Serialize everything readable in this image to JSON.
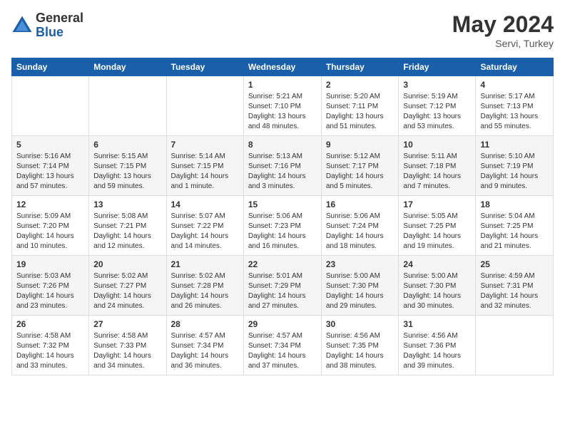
{
  "header": {
    "logo_general": "General",
    "logo_blue": "Blue",
    "month_year": "May 2024",
    "location": "Servi, Turkey"
  },
  "weekdays": [
    "Sunday",
    "Monday",
    "Tuesday",
    "Wednesday",
    "Thursday",
    "Friday",
    "Saturday"
  ],
  "weeks": [
    [
      {
        "day": "",
        "info": ""
      },
      {
        "day": "",
        "info": ""
      },
      {
        "day": "",
        "info": ""
      },
      {
        "day": "1",
        "info": "Sunrise: 5:21 AM\nSunset: 7:10 PM\nDaylight: 13 hours\nand 48 minutes."
      },
      {
        "day": "2",
        "info": "Sunrise: 5:20 AM\nSunset: 7:11 PM\nDaylight: 13 hours\nand 51 minutes."
      },
      {
        "day": "3",
        "info": "Sunrise: 5:19 AM\nSunset: 7:12 PM\nDaylight: 13 hours\nand 53 minutes."
      },
      {
        "day": "4",
        "info": "Sunrise: 5:17 AM\nSunset: 7:13 PM\nDaylight: 13 hours\nand 55 minutes."
      }
    ],
    [
      {
        "day": "5",
        "info": "Sunrise: 5:16 AM\nSunset: 7:14 PM\nDaylight: 13 hours\nand 57 minutes."
      },
      {
        "day": "6",
        "info": "Sunrise: 5:15 AM\nSunset: 7:15 PM\nDaylight: 13 hours\nand 59 minutes."
      },
      {
        "day": "7",
        "info": "Sunrise: 5:14 AM\nSunset: 7:15 PM\nDaylight: 14 hours\nand 1 minute."
      },
      {
        "day": "8",
        "info": "Sunrise: 5:13 AM\nSunset: 7:16 PM\nDaylight: 14 hours\nand 3 minutes."
      },
      {
        "day": "9",
        "info": "Sunrise: 5:12 AM\nSunset: 7:17 PM\nDaylight: 14 hours\nand 5 minutes."
      },
      {
        "day": "10",
        "info": "Sunrise: 5:11 AM\nSunset: 7:18 PM\nDaylight: 14 hours\nand 7 minutes."
      },
      {
        "day": "11",
        "info": "Sunrise: 5:10 AM\nSunset: 7:19 PM\nDaylight: 14 hours\nand 9 minutes."
      }
    ],
    [
      {
        "day": "12",
        "info": "Sunrise: 5:09 AM\nSunset: 7:20 PM\nDaylight: 14 hours\nand 10 minutes."
      },
      {
        "day": "13",
        "info": "Sunrise: 5:08 AM\nSunset: 7:21 PM\nDaylight: 14 hours\nand 12 minutes."
      },
      {
        "day": "14",
        "info": "Sunrise: 5:07 AM\nSunset: 7:22 PM\nDaylight: 14 hours\nand 14 minutes."
      },
      {
        "day": "15",
        "info": "Sunrise: 5:06 AM\nSunset: 7:23 PM\nDaylight: 14 hours\nand 16 minutes."
      },
      {
        "day": "16",
        "info": "Sunrise: 5:06 AM\nSunset: 7:24 PM\nDaylight: 14 hours\nand 18 minutes."
      },
      {
        "day": "17",
        "info": "Sunrise: 5:05 AM\nSunset: 7:25 PM\nDaylight: 14 hours\nand 19 minutes."
      },
      {
        "day": "18",
        "info": "Sunrise: 5:04 AM\nSunset: 7:25 PM\nDaylight: 14 hours\nand 21 minutes."
      }
    ],
    [
      {
        "day": "19",
        "info": "Sunrise: 5:03 AM\nSunset: 7:26 PM\nDaylight: 14 hours\nand 23 minutes."
      },
      {
        "day": "20",
        "info": "Sunrise: 5:02 AM\nSunset: 7:27 PM\nDaylight: 14 hours\nand 24 minutes."
      },
      {
        "day": "21",
        "info": "Sunrise: 5:02 AM\nSunset: 7:28 PM\nDaylight: 14 hours\nand 26 minutes."
      },
      {
        "day": "22",
        "info": "Sunrise: 5:01 AM\nSunset: 7:29 PM\nDaylight: 14 hours\nand 27 minutes."
      },
      {
        "day": "23",
        "info": "Sunrise: 5:00 AM\nSunset: 7:30 PM\nDaylight: 14 hours\nand 29 minutes."
      },
      {
        "day": "24",
        "info": "Sunrise: 5:00 AM\nSunset: 7:30 PM\nDaylight: 14 hours\nand 30 minutes."
      },
      {
        "day": "25",
        "info": "Sunrise: 4:59 AM\nSunset: 7:31 PM\nDaylight: 14 hours\nand 32 minutes."
      }
    ],
    [
      {
        "day": "26",
        "info": "Sunrise: 4:58 AM\nSunset: 7:32 PM\nDaylight: 14 hours\nand 33 minutes."
      },
      {
        "day": "27",
        "info": "Sunrise: 4:58 AM\nSunset: 7:33 PM\nDaylight: 14 hours\nand 34 minutes."
      },
      {
        "day": "28",
        "info": "Sunrise: 4:57 AM\nSunset: 7:34 PM\nDaylight: 14 hours\nand 36 minutes."
      },
      {
        "day": "29",
        "info": "Sunrise: 4:57 AM\nSunset: 7:34 PM\nDaylight: 14 hours\nand 37 minutes."
      },
      {
        "day": "30",
        "info": "Sunrise: 4:56 AM\nSunset: 7:35 PM\nDaylight: 14 hours\nand 38 minutes."
      },
      {
        "day": "31",
        "info": "Sunrise: 4:56 AM\nSunset: 7:36 PM\nDaylight: 14 hours\nand 39 minutes."
      },
      {
        "day": "",
        "info": ""
      }
    ]
  ]
}
